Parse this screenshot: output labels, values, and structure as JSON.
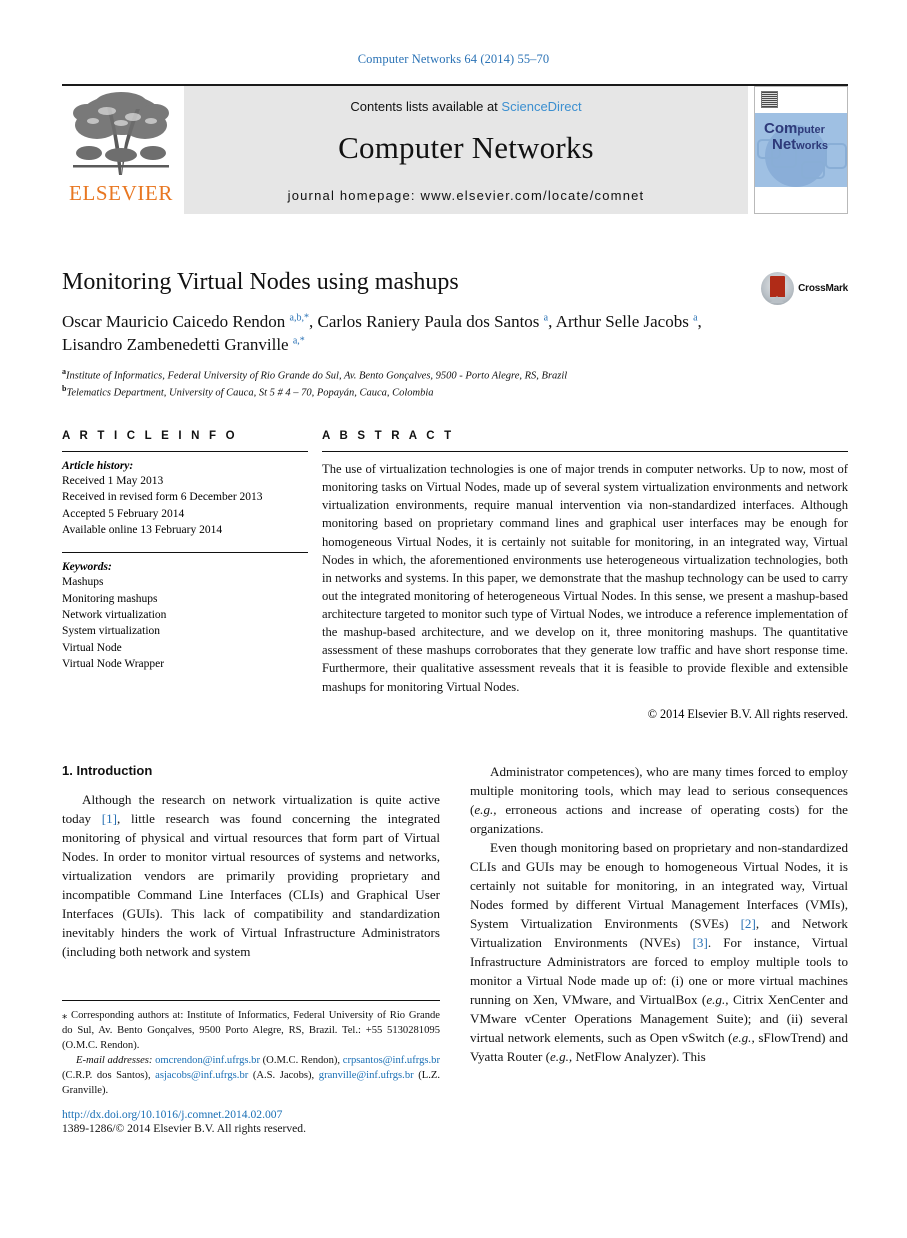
{
  "running_head": "Computer Networks 64 (2014) 55–70",
  "masthead": {
    "publisher_logo_name": "elsevier-tree-logo",
    "publisher_wordmark": "ELSEVIER",
    "contents_prefix": "Contents lists available at",
    "contents_link": "ScienceDirect",
    "journal_title": "Computer Networks",
    "homepage_label": "journal homepage: www.elsevier.com/locate/comnet",
    "cover": {
      "line1_bold": "Com",
      "line1_rest": "puter",
      "line2_bold": "Net",
      "line2_rest": "works"
    },
    "link_color": "#3b8fd0"
  },
  "article": {
    "title": "Monitoring Virtual Nodes using mashups",
    "crossmark_label": "CrossMark",
    "authors_html": "Oscar Mauricio Caicedo Rendon <sup>a,b,*</sup>, Carlos Raniery Paula dos Santos <sup>a</sup>, Arthur Selle Jacobs <sup>a</sup>, Lisandro Zambenedetti Granville <sup>a,*</sup>",
    "affiliations": [
      {
        "marker": "a",
        "text": "Institute of Informatics, Federal University of Rio Grande do Sul, Av. Bento Gonçalves, 9500 - Porto Alegre, RS, Brazil"
      },
      {
        "marker": "b",
        "text": "Telematics Department, University of Cauca, St 5 # 4 – 70, Popayán, Cauca, Colombia"
      }
    ]
  },
  "article_info": {
    "heading": "A R T I C L E   I N F O",
    "history_label": "Article history:",
    "history": [
      "Received 1 May 2013",
      "Received in revised form 6 December 2013",
      "Accepted 5 February 2014",
      "Available online 13 February 2014"
    ],
    "keywords_label": "Keywords:",
    "keywords": [
      "Mashups",
      "Monitoring mashups",
      "Network virtualization",
      "System virtualization",
      "Virtual Node",
      "Virtual Node Wrapper"
    ]
  },
  "abstract": {
    "heading": "A B S T R A C T",
    "text": "The use of virtualization technologies is one of major trends in computer networks. Up to now, most of monitoring tasks on Virtual Nodes, made up of several system virtualization environments and network virtualization environments, require manual intervention via non-standardized interfaces. Although monitoring based on proprietary command lines and graphical user interfaces may be enough for homogeneous Virtual Nodes, it is certainly not suitable for monitoring, in an integrated way, Virtual Nodes in which, the aforementioned environments use heterogeneous virtualization technologies, both in networks and systems. In this paper, we demonstrate that the mashup technology can be used to carry out the integrated monitoring of heterogeneous Virtual Nodes. In this sense, we present a mashup-based architecture targeted to monitor such type of Virtual Nodes, we introduce a reference implementation of the mashup-based architecture, and we develop on it, three monitoring mashups. The quantitative assessment of these mashups corroborates that they generate low traffic and have short response time. Furthermore, their qualitative assessment reveals that it is feasible to provide flexible and extensible mashups for monitoring Virtual Nodes.",
    "copyright": "© 2014 Elsevier B.V. All rights reserved."
  },
  "body": {
    "section_number_title": "1. Introduction",
    "left_paragraphs": [
      "Although the research on network virtualization is quite active today [1], little research was found concerning the integrated monitoring of physical and virtual resources that form part of Virtual Nodes. In order to monitor virtual resources of systems and networks, virtualization vendors are primarily providing proprietary and incompatible Command Line Interfaces (CLIs) and Graphical User Interfaces (GUIs). This lack of compatibility and standardization inevitably hinders the work of Virtual Infrastructure Administrators (including both network and system"
    ],
    "right_paragraphs": [
      "Administrator competences), who are many times forced to employ multiple monitoring tools, which may lead to serious consequences (e.g., erroneous actions and increase of operating costs) for the organizations.",
      "Even though monitoring based on proprietary and non-standardized CLIs and GUIs may be enough to homogeneous Virtual Nodes, it is certainly not suitable for monitoring, in an integrated way, Virtual Nodes formed by different Virtual Management Interfaces (VMIs), System Virtualization Environments (SVEs) [2], and Network Virtualization Environments (NVEs) [3]. For instance, Virtual Infrastructure Administrators are forced to employ multiple tools to monitor a Virtual Node made up of: (i) one or more virtual machines running on Xen, VMware, and VirtualBox (e.g., Citrix XenCenter and VMware vCenter Operations Management Suite); and (ii) several virtual network elements, such as Open vSwitch (e.g., sFlowTrend) and Vyatta Router (e.g., NetFlow Analyzer). This"
    ]
  },
  "footnote": {
    "corresponding": "Corresponding authors at: Institute of Informatics, Federal University of Rio Grande do Sul, Av. Bento Gonçalves, 9500 Porto Alegre, RS, Brazil. Tel.: +55 5130281095 (O.M.C. Rendon).",
    "email_label": "E-mail addresses:",
    "emails": [
      {
        "address": "omcrendon@inf.ufrgs.br",
        "owner": "(O.M.C. Rendon),"
      },
      {
        "address": "crpsantos@inf.ufrgs.br",
        "owner": "(C.R.P. dos Santos),"
      },
      {
        "address": "asjacobs@inf.ufrgs.br",
        "owner": "(A.S. Jacobs),"
      },
      {
        "address": "granville@inf.ufrgs.br",
        "owner": "(L.Z. Granville)."
      }
    ],
    "doi": "http://dx.doi.org/10.1016/j.comnet.2014.02.007",
    "issn_line": "1389-1286/© 2014 Elsevier B.V. All rights reserved."
  },
  "colors": {
    "link": "#1a6fb5",
    "ref": "#2a72b5",
    "elsevier_orange": "#e87722",
    "cover_blue": "#9fc0e3"
  }
}
